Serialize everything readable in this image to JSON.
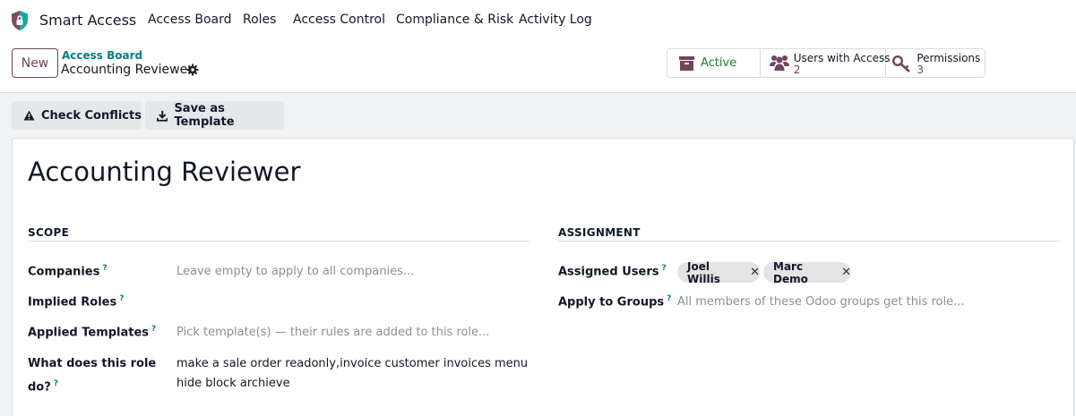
{
  "app": {
    "name": "Smart Access",
    "menu": [
      "Access Board",
      "Roles",
      "Access Control",
      "Compliance & Risk",
      "Activity Log"
    ]
  },
  "control": {
    "new_label": "New",
    "breadcrumb_parent": "Access Board",
    "breadcrumb_current": "Accounting Reviewer",
    "stats": {
      "active_label": "Active",
      "users_label": "Users with Access",
      "users_value": "2",
      "permissions_label": "Permissions",
      "permissions_value": "3"
    }
  },
  "actions": {
    "check_conflicts": "Check Conflicts",
    "save_template": "Save as Template"
  },
  "form": {
    "title": "Accounting Reviewer",
    "scope": {
      "section_title": "SCOPE",
      "companies_label": "Companies",
      "companies_placeholder": "Leave empty to apply to all companies...",
      "implied_roles_label": "Implied Roles",
      "applied_templates_label": "Applied Templates",
      "applied_templates_placeholder": "Pick template(s) — their rules are added to this role...",
      "description_label_line1": "What does this role",
      "description_label_line2": "do?",
      "description_line1": "make a sale order readonly,invoice customer invoices menu",
      "description_line2": "hide block archieve"
    },
    "assignment": {
      "section_title": "ASSIGNMENT",
      "assigned_users_label": "Assigned Users",
      "assigned_users": [
        "Joel Willis",
        "Marc Demo"
      ],
      "apply_groups_label": "Apply to Groups",
      "apply_groups_placeholder": "All members of these Odoo groups get this role..."
    },
    "help_marker": "?"
  },
  "colors": {
    "brand": "#71445e",
    "teal": "#017e84",
    "active_green": "#1f7a2f"
  }
}
